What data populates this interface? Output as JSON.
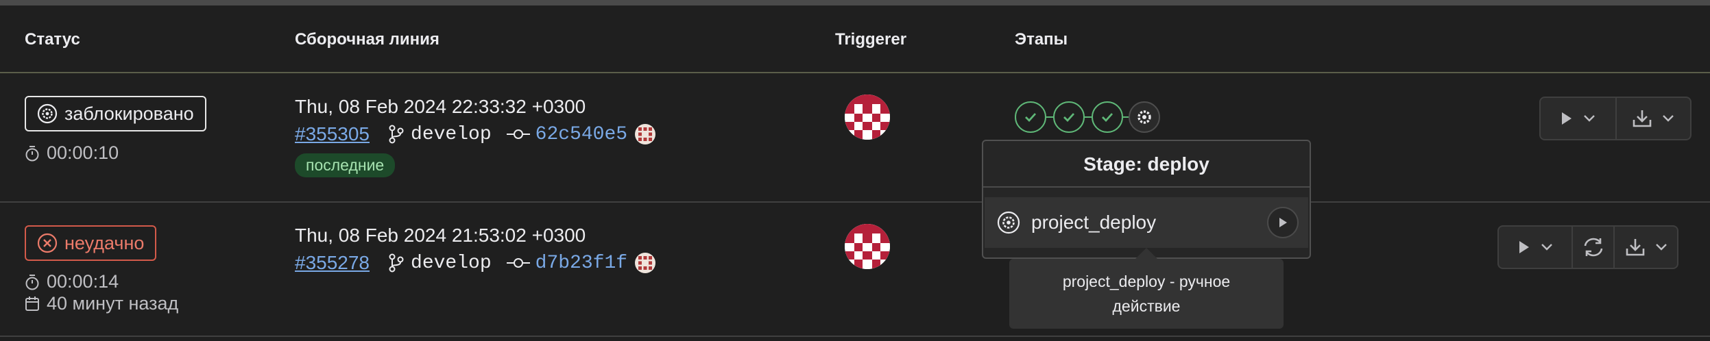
{
  "header": {
    "status": "Статус",
    "pipeline": "Сборочная линия",
    "triggerer": "Triggerer",
    "stages": "Этапы"
  },
  "rows": [
    {
      "status_label": "заблокировано",
      "duration": "00:00:10",
      "date": "Thu, 08 Feb 2024 22:33:32 +0300",
      "pipeline_id": "#355305",
      "branch": "develop",
      "commit": "62c540e5",
      "badge": "последние",
      "stages": [
        "success",
        "success",
        "success",
        "manual"
      ]
    },
    {
      "status_label": "неудачно",
      "duration": "00:00:14",
      "finished": "40 минут назад",
      "date": "Thu, 08 Feb 2024 21:53:02 +0300",
      "pipeline_id": "#355278",
      "branch": "develop",
      "commit": "d7b23f1f"
    }
  ],
  "stage_dropdown": {
    "title": "Stage: deploy",
    "job": "project_deploy"
  },
  "tooltip": "project_deploy - ручное действие",
  "colors": {
    "success": "#5fb878",
    "failed": "#ec7b6a",
    "link": "#7aa9e6",
    "avatar": "#b5203a"
  }
}
